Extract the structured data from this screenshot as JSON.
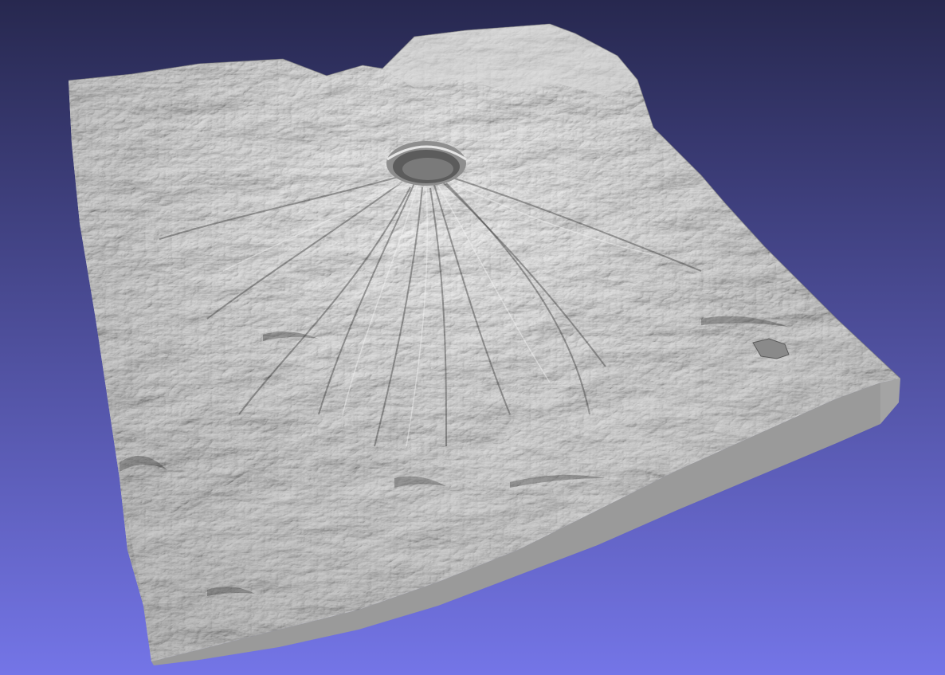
{
  "viewer": {
    "background": {
      "top_color": "#27284f",
      "bottom_color": "#7475e7"
    },
    "model": {
      "name": "terrain-mesh",
      "surface_color": "#bdbdbd",
      "highlight_color": "#ececec",
      "shadow_color": "#3a3a3a",
      "side_color": "#a4a4a4",
      "side_front_color": "#9a9a9a"
    }
  }
}
